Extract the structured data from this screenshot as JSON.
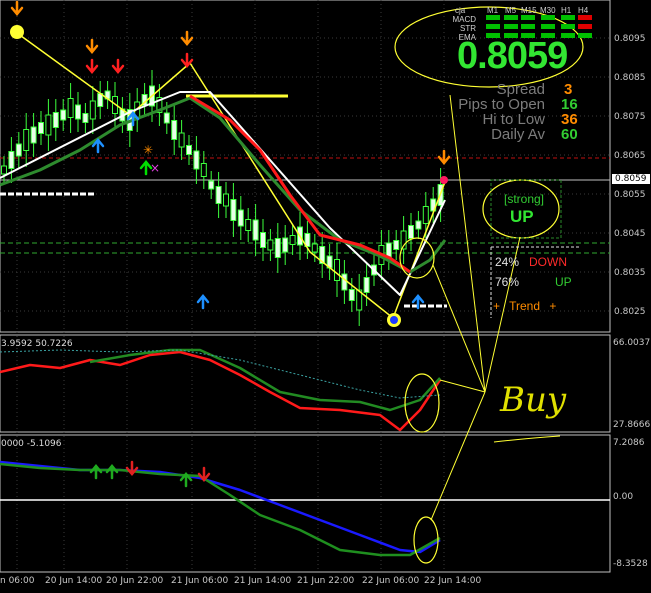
{
  "price_panel": {
    "price_display": "0.8059",
    "stats": [
      {
        "label": "Spread",
        "value": "3",
        "color": "#ff8c00"
      },
      {
        "label": "Pips to Open",
        "value": "16",
        "color": "#32cd32"
      },
      {
        "label": "Hi to Low",
        "value": "36",
        "color": "#ff8c00"
      },
      {
        "label": "Daily Av",
        "value": "60",
        "color": "#32cd32"
      }
    ],
    "signal_strength": "[strong]",
    "signal_direction": "UP",
    "down_pct": "24%",
    "down_label": "DOWN",
    "up_pct": "76%",
    "up_label": "UP",
    "trend_label": "+ Trend +"
  },
  "tf_matrix": {
    "headers": [
      "cja",
      "M1",
      "M5",
      "M15",
      "M30",
      "H1",
      "H4"
    ],
    "rows": [
      "MACD",
      "STR",
      "EMA"
    ],
    "colors": {
      "green": "#00c000",
      "red": "#e00000"
    }
  },
  "price_axis": {
    "ticks": [
      "0.8095",
      "0.8085",
      "0.8075",
      "0.8065",
      "0.8055",
      "0.8045",
      "0.8035",
      "0.8025"
    ],
    "current_price": "0.8059"
  },
  "indicator1": {
    "header": "3.9592 50.7226",
    "axis_top": "66.0037",
    "axis_bottom": "27.8666"
  },
  "indicator2": {
    "header": "0000 -5.1096",
    "axis_top": "7.2086",
    "axis_mid": "0.00",
    "axis_bottom": "-8.3528"
  },
  "time_axis": [
    "n 06:00",
    "20 Jun 14:00",
    "20 Jun 22:00",
    "21 Jun 06:00",
    "21 Jun 14:00",
    "21 Jun 22:00",
    "22 Jun 06:00",
    "22 Jun 14:00"
  ],
  "annotation": {
    "handwritten_text": "Buy"
  },
  "colors": {
    "background": "#000000",
    "grid": "#3a3a3a",
    "candle_up": "#e8ffe8",
    "candle_down": "#3cff3c",
    "zigzag": "#ffff33",
    "channel": "#ffffff",
    "red_ma": "#ff1a1a",
    "green_ma": "#2e8b2e",
    "blue_ma": "#1a1aff"
  }
}
